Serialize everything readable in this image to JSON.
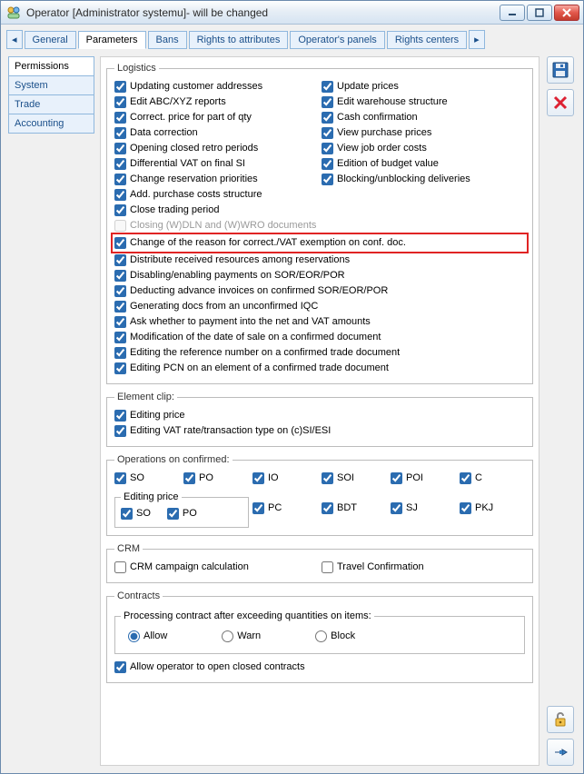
{
  "window": {
    "title": "Operator [Administrator systemu]- will be changed"
  },
  "tabs": {
    "items": [
      "General",
      "Parameters",
      "Bans",
      "Rights to attributes",
      "Operator's panels",
      "Rights centers"
    ],
    "active": "Parameters",
    "arrow_left": "◂",
    "arrow_right": "▸"
  },
  "side_tabs": {
    "items": [
      "Permissions",
      "System",
      "Trade",
      "Accounting"
    ],
    "active": "Permissions"
  },
  "logistics": {
    "legend": "Logistics",
    "left": [
      "Updating customer addresses",
      "Edit ABC/XYZ reports",
      "Correct. price for part of qty",
      "Data correction",
      "Opening closed retro periods",
      "Differential VAT on final SI",
      "Change reservation priorities",
      "Add. purchase costs structure",
      "Close trading period"
    ],
    "right": [
      "Update prices",
      "Edit warehouse structure",
      "Cash confirmation",
      "View purchase prices",
      "View job order costs",
      "Edition of budget value",
      "Blocking/unblocking deliveries"
    ],
    "disabled": "Closing (W)DLN and (W)WRO documents",
    "highlighted": "Change of the reason for correct./VAT exemption on conf. doc.",
    "full_width": [
      "Distribute received resources among reservations",
      "Disabling/enabling payments on SOR/EOR/POR",
      "Deducting advance invoices on confirmed SOR/EOR/POR",
      "Generating docs from an unconfirmed IQC",
      "Ask whether to payment into the net and VAT amounts",
      "Modification of the date of sale on a confirmed document",
      "Editing the reference number on a confirmed trade document",
      "Editing PCN on an element of a confirmed trade document"
    ]
  },
  "element_clip": {
    "legend": "Element clip:",
    "items": [
      "Editing price",
      "Editing VAT rate/transaction type on (c)SI/ESI"
    ]
  },
  "ops_confirmed": {
    "legend": "Operations on confirmed:",
    "row1": [
      "SO",
      "PO",
      "IO",
      "SOI",
      "POI",
      "C"
    ],
    "editing_price_legend": "Editing price",
    "row2_left": [
      "SO",
      "PO"
    ],
    "row2_right": [
      "PC",
      "BDT",
      "SJ",
      "PKJ"
    ]
  },
  "crm": {
    "legend": "CRM",
    "items": [
      "CRM campaign calculation",
      "Travel Confirmation"
    ]
  },
  "contracts": {
    "legend": "Contracts",
    "inner_legend": "Processing contract after exceeding quantities on items:",
    "radios": [
      "Allow",
      "Warn",
      "Block"
    ],
    "radio_selected": "Allow",
    "allow_open": "Allow operator to open closed contracts"
  }
}
